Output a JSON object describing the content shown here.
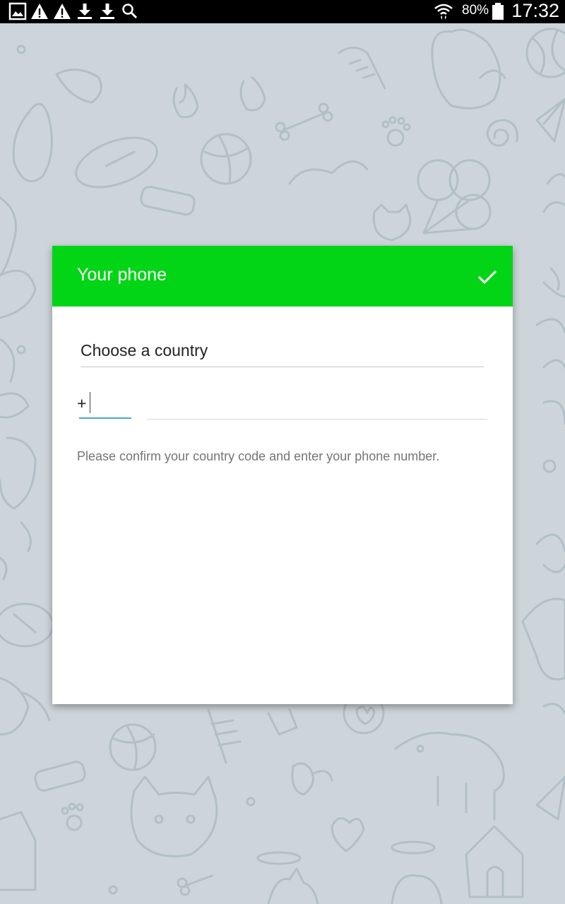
{
  "status_bar": {
    "left_icons": [
      "gallery-icon",
      "warning-icon",
      "warning-icon",
      "download-icon",
      "download-icon",
      "search-icon"
    ],
    "right_icons": [
      "wifi-icon",
      "battery-icon"
    ],
    "battery": "80%",
    "time": "17:32"
  },
  "dialog": {
    "title": "Your phone",
    "confirm_icon": "checkmark-icon",
    "country_field": "Choose a country",
    "code_prefix": "+",
    "code_value": "",
    "phone_value": "",
    "hint": "Please confirm your country code and enter your phone number."
  },
  "colors": {
    "header": "#02d515",
    "background": "#cdd5da",
    "doodle": "#b2bfc6",
    "input_focus": "#4aa3df"
  }
}
